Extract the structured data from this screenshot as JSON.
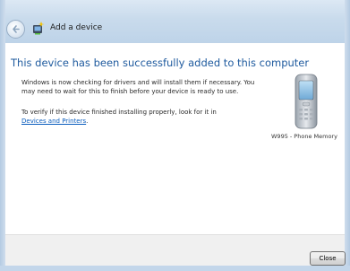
{
  "window": {
    "title": "Add a device",
    "title_icon": "add-device-icon",
    "back_icon": "back-arrow-icon",
    "accent": "#1e5a9e"
  },
  "main": {
    "heading": "This device has been successfully added to this computer",
    "para1": "Windows is now checking for drivers and will install them if necessary. You may need to wait for this to finish before your device is ready to use.",
    "para2_text": "To verify if this device finished installing properly, look for it in",
    "para2_link": "Devices and Printers",
    "para2_end": "."
  },
  "device": {
    "icon": "mobile-phone-icon",
    "name": "W995 - Phone Memory"
  },
  "footer": {
    "close_label": "Close"
  }
}
